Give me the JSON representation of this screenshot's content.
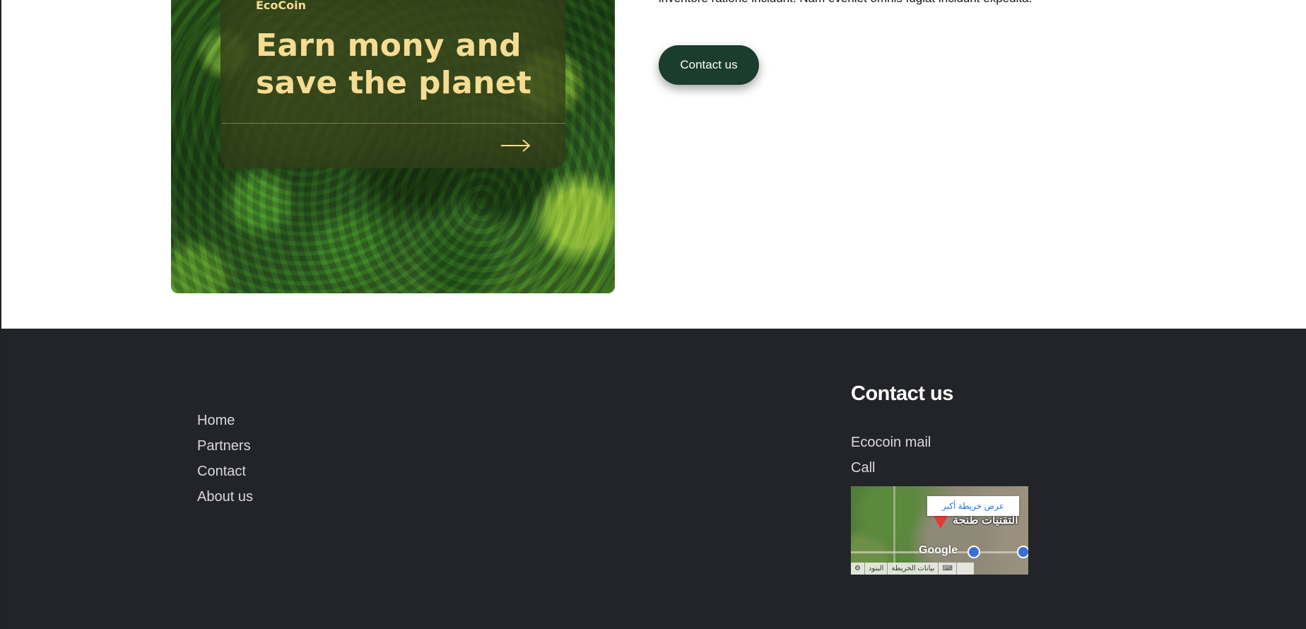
{
  "promo": {
    "brand": "EcoCoin",
    "headline": "Earn mony and save the planet"
  },
  "intro": {
    "text": "inventore ratione incidunt. Nam eveniet omnis fugiat incidunt expedita."
  },
  "contact_button": {
    "label": "Contact us"
  },
  "footer": {
    "nav": [
      "Home",
      "Partners",
      "Contact",
      "About us"
    ],
    "contact_title": "Contact us",
    "mail_label": "Ecocoin mail",
    "call_label": "Call",
    "map": {
      "enlarge_label": "عرض خريطة أكبر",
      "place_label": "التقنيات طنجة",
      "google_label": "Google",
      "terms_label": "البنود",
      "map_data_label": "بيانات الخريطة"
    }
  },
  "colors": {
    "accent_gold": "#f6dc92",
    "button_green": "#1a3d2d",
    "footer_bg": "#232429"
  }
}
